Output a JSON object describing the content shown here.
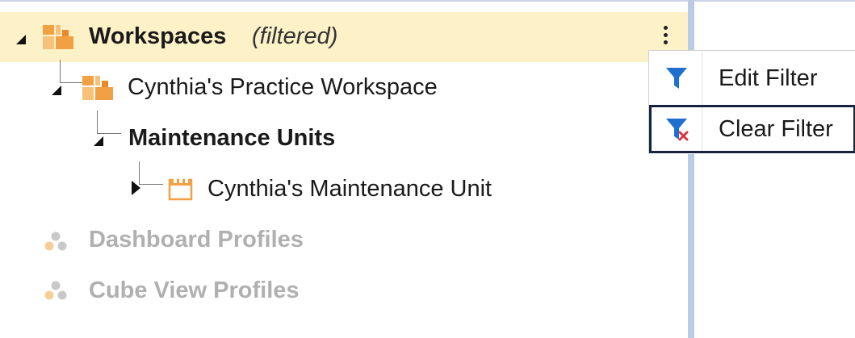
{
  "tree": {
    "workspaces": {
      "label": "Workspaces",
      "suffix": "(filtered)"
    },
    "practice_workspace": {
      "label": "Cynthia's Practice Workspace"
    },
    "maintenance_units": {
      "label": "Maintenance Units"
    },
    "maintenance_unit": {
      "label": "Cynthia's Maintenance Unit"
    },
    "dashboard_profiles": {
      "label": "Dashboard Profiles"
    },
    "cube_view_profiles": {
      "label": "Cube View Profiles"
    }
  },
  "context_menu": {
    "items": [
      {
        "label": "Edit Filter",
        "icon": "filter-icon"
      },
      {
        "label": "Clear Filter",
        "icon": "clear-filter-icon"
      }
    ]
  },
  "colors": {
    "selected_row": "#fdf1c7",
    "accent_orange": "#f2a044",
    "filter_blue": "#1f6fd1",
    "focus_border": "#17233d",
    "muted_text": "#b0b0b0"
  }
}
